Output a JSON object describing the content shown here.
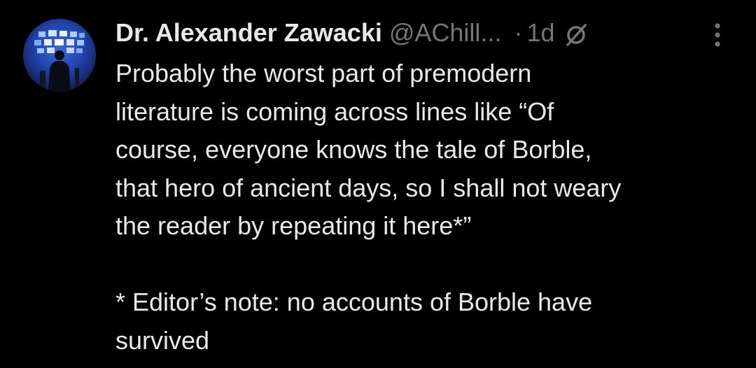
{
  "tweet": {
    "author_name": "Dr. Alexander Zawacki",
    "handle": "@AChill...",
    "separator": "·",
    "time": "1d",
    "body": "Probably the worst part of premodern\nliterature is coming across lines like “Of\ncourse, everyone knows the tale of Borble,\nthat hero of ancient days, so I shall not weary\nthe reader by repeating it here*”\n\n* Editor’s note: no accounts of Borble have\nsurvived"
  },
  "icons": {
    "avatar": "avatar-image",
    "grok": "grok-icon",
    "more": "more-vertical-icon"
  },
  "colors": {
    "background": "#000000",
    "primary_text": "#e7e9ea",
    "secondary_text": "#71767b"
  }
}
